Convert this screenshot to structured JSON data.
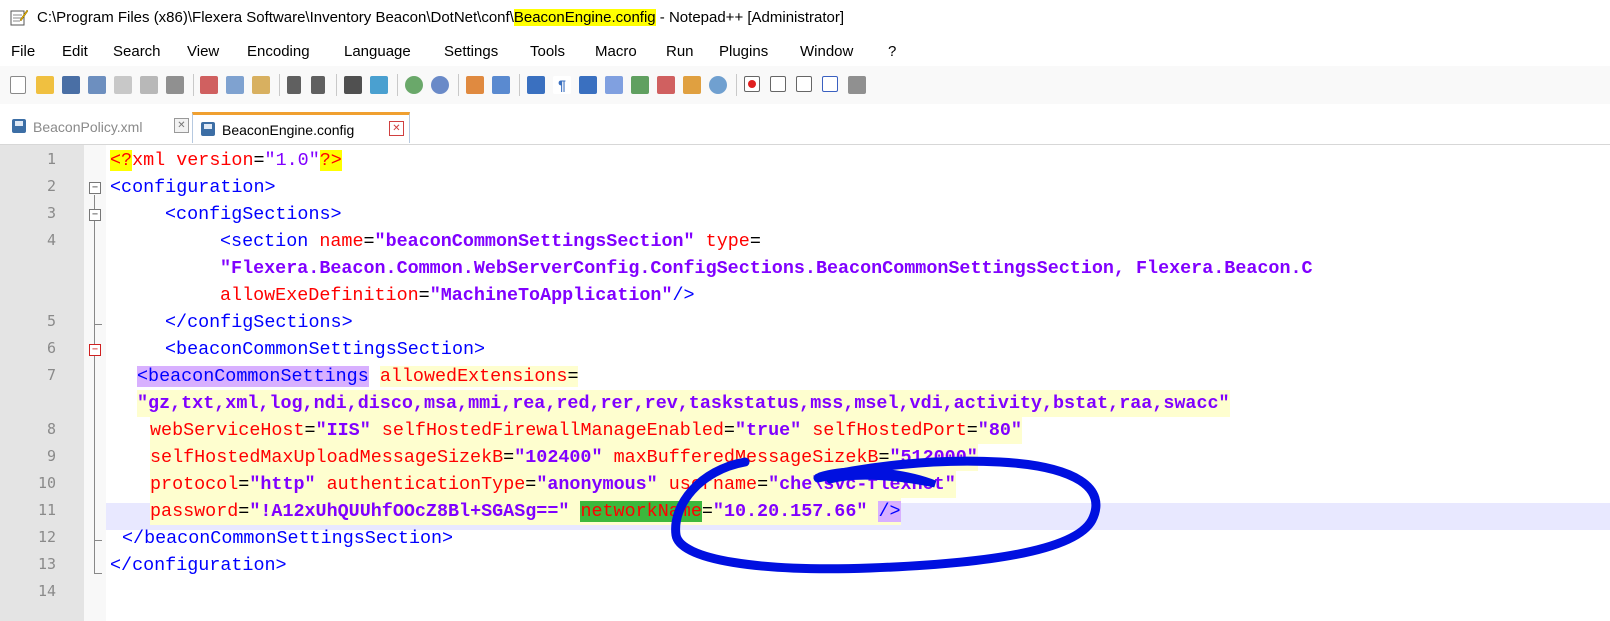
{
  "window": {
    "title_prefix": "C:\\Program Files (x86)\\Flexera Software\\Inventory Beacon\\DotNet\\conf\\",
    "title_file": "BeaconEngine.config",
    "title_suffix": " - Notepad++ [Administrator]"
  },
  "menu": [
    "File",
    "Edit",
    "Search",
    "View",
    "Encoding",
    "Language",
    "Settings",
    "Tools",
    "Macro",
    "Run",
    "Plugins",
    "Window",
    "?"
  ],
  "toolbar_icons": [
    "new-file-icon",
    "open-file-icon",
    "save-icon",
    "save-all-icon",
    "close-icon",
    "close-all-icon",
    "print-icon",
    "cut-icon",
    "copy-icon",
    "paste-icon",
    "undo-icon",
    "redo-icon",
    "find-icon",
    "replace-icon",
    "zoom-in-icon",
    "zoom-out-icon",
    "sync-vertical-icon",
    "sync-horizontal-icon",
    "word-wrap-icon",
    "show-all-chars-icon",
    "indent-guide-icon",
    "language-icon",
    "doc-map-icon",
    "function-list-icon",
    "folder-as-workspace-icon",
    "monitoring-icon",
    "record-macro-icon",
    "stop-record-icon",
    "play-macro-icon",
    "run-macro-multiple-icon",
    "save-macro-icon"
  ],
  "tabs": [
    {
      "label": "BeaconPolicy.xml",
      "close": "✕"
    },
    {
      "label": "BeaconEngine.config",
      "close": "✕"
    }
  ],
  "line_numbers": [
    "1",
    "2",
    "3",
    "4",
    "5",
    "6",
    "7",
    "8",
    "9",
    "10",
    "11",
    "12",
    "13",
    "14"
  ],
  "fold_markers": {
    "minus": "−"
  },
  "code": {
    "l1_pi_open": "<?",
    "l1_tag": "xml",
    "l1_attr": "version",
    "l1_eq": "=",
    "l1_val": "\"1.0\"",
    "l1_pi_close": "?>",
    "l2": "<configuration>",
    "l3": "<configSections>",
    "l4_tag": "<section",
    "l4_attr1": "name",
    "l4_eq": "=",
    "l4_val1": "\"beaconCommonSettingsSection\"",
    "l4_attr2": "type",
    "l4_eq2": "=",
    "l4_wrap1": "\"Flexera.Beacon.Common.WebServerConfig.ConfigSections.BeaconCommonSettingsSection, Flexera.Beacon.C",
    "l4_attr3": "allowExeDefinition",
    "l4_eq3": "=",
    "l4_val3": "\"MachineToApplication\"",
    "l4_close": "/>",
    "l5": "</configSections>",
    "l6": "<beaconCommonSettingsSection>",
    "l7_tag": "<beaconCommonSettings",
    "l7_attr": "allowedExtensions",
    "l7_eq": "=",
    "l7_val": "\"gz,txt,xml,log,ndi,disco,msa,mmi,rea,red,rer,rev,taskstatus,mss,msel,vdi,activity,bstat,raa,swacc\"",
    "l8_attr1": "webServiceHost",
    "l8_val1": "\"IIS\"",
    "l8_attr2": "selfHostedFirewallManageEnabled",
    "l8_val2": "\"true\"",
    "l8_attr3": "selfHostedPort",
    "l8_val3": "\"80\"",
    "l9_attr1": "selfHostedMaxUploadMessageSizekB",
    "l9_val1": "\"102400\"",
    "l9_attr2": "maxBufferedMessageSizekB",
    "l9_val2": "\"512000\"",
    "l10_attr1": "protocol",
    "l10_val1": "\"http\"",
    "l10_attr2": "authenticationType",
    "l10_val2": "\"anonymous\"",
    "l10_attr3": "username",
    "l10_val3": "\"che\\svc-flexnet\"",
    "l11_attr1": "password",
    "l11_val1": "\"!A12xUhQUUhfOOcZ8Bl+SGASg==\"",
    "l11_attr2": "networkName",
    "l11_val2": "\"10.20.157.66\"",
    "l11_close": "/>",
    "l12": "</beaconCommonSettingsSection>",
    "l13": "</configuration>",
    "eq": "="
  },
  "colors": {
    "tag": "#0000ff",
    "attribute": "#ff0000",
    "value": "#8000ff",
    "highlight_yellow": "#ffff00",
    "annotation_ink": "#0010e0"
  }
}
